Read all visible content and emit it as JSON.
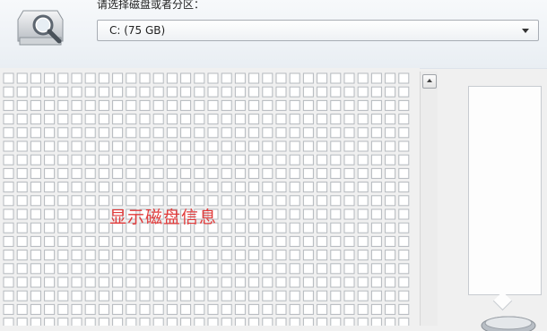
{
  "header": {
    "prompt_label": "请选择磁盘或者分区：",
    "icon": "disk-search-icon"
  },
  "drive_select": {
    "value": "C:  (75 GB)",
    "icon": "chevron-down-icon"
  },
  "grid": {
    "overlay_text": "显示磁盘信息",
    "overlay_color": "#e23b3b"
  },
  "scrollbar": {
    "up_icon": "arrow-up-icon"
  },
  "legend": {
    "icon": "disk-icon"
  }
}
